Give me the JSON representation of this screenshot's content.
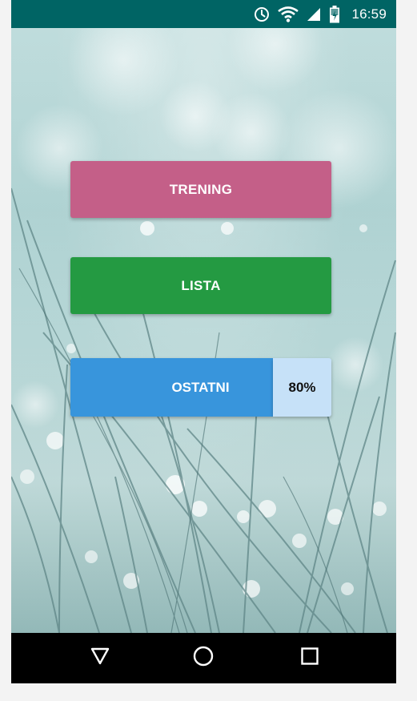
{
  "status_bar": {
    "time": "16:59",
    "icons": [
      "alarm-clock-icon",
      "wifi-icon",
      "cell-signal-icon",
      "battery-charging-icon"
    ],
    "background_color": "#006464"
  },
  "main": {
    "buttons": {
      "trening": {
        "label": "TRENING",
        "color": "#c45f88"
      },
      "lista": {
        "label": "LISTA",
        "color": "#249a42"
      },
      "ostatni": {
        "label": "OSTATNI",
        "color": "#3895dc",
        "percent": "80%"
      }
    }
  },
  "nav_bar": {
    "icons": [
      "back-triangle-icon",
      "home-circle-icon",
      "recents-square-icon"
    ]
  }
}
